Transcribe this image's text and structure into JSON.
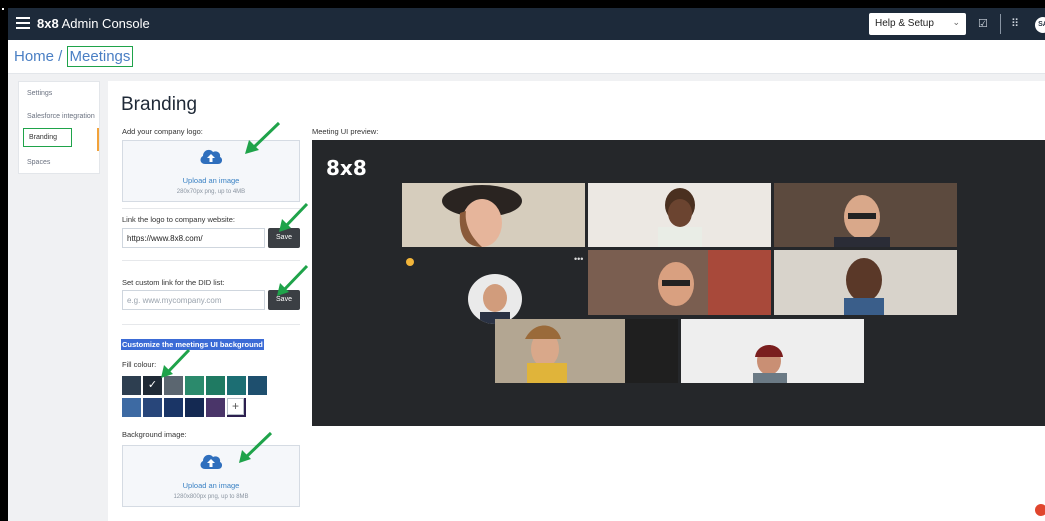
{
  "app": {
    "brand_bold": "8x8",
    "brand_rest": " Admin Console"
  },
  "topbar": {
    "help_label": "Help & Setup",
    "avatar_initials": "SA"
  },
  "breadcrumb": {
    "home": "Home",
    "separator": " / ",
    "current": "Meetings"
  },
  "sidebar": {
    "items": [
      {
        "label": "Settings"
      },
      {
        "label": "Salesforce integration"
      },
      {
        "label": "Branding"
      },
      {
        "label": "Spaces"
      }
    ]
  },
  "branding": {
    "title": "Branding",
    "logo_label": "Add your company logo:",
    "logo_upload": {
      "cta": "Upload an image",
      "hint": "280x70px png, up to 4MB"
    },
    "website_label": "Link the logo to company website:",
    "website_value": "https://www.8x8.com/",
    "save_label": "Save",
    "did_label": "Set custom link for the DID list:",
    "did_placeholder": "e.g. www.mycompany.com",
    "customize_heading": "Customize the meetings UI background",
    "fill_label": "Fill colour:",
    "swatches": [
      "#2d3e50",
      "#1f2a36",
      "#5b6670",
      "#2b8a6c",
      "#1f7a62",
      "#1c6e73",
      "#1e4f6e",
      "#3d6aa3",
      "#28467a",
      "#1a3566",
      "#142952",
      "#4a3569",
      "#2c1f4f"
    ],
    "selected_swatch": 1,
    "bg_label": "Background image:",
    "bg_upload": {
      "cta": "Upload an image",
      "hint": "1280x800px png, up to 8MB"
    }
  },
  "preview": {
    "label": "Meeting UI preview:",
    "logo": "8x8"
  },
  "colors": {
    "accent": "#1fa34a",
    "topbar": "#1d2a3a",
    "link": "#4a7fc4"
  }
}
